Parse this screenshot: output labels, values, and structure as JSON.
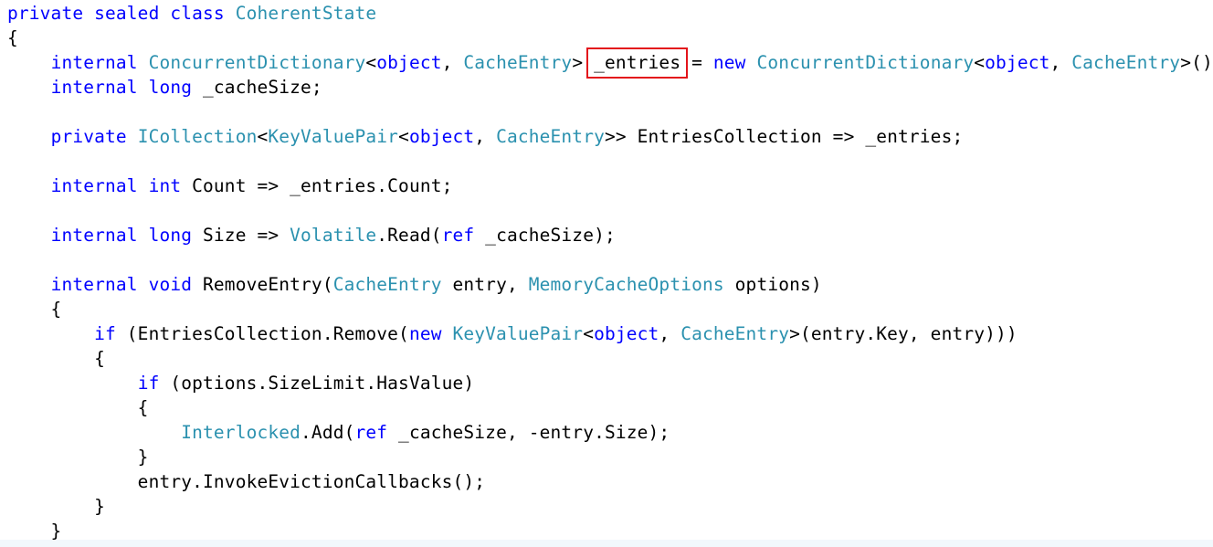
{
  "colors": {
    "keyword": "#0000ff",
    "type": "#2b91af",
    "text": "#000000",
    "highlight_box": "#e3141b",
    "background": "#ffffff"
  },
  "code_lines": [
    [
      {
        "t": "private",
        "k": "kw"
      },
      {
        "t": " ",
        "k": "pl"
      },
      {
        "t": "sealed",
        "k": "kw"
      },
      {
        "t": " ",
        "k": "pl"
      },
      {
        "t": "class",
        "k": "kw"
      },
      {
        "t": " ",
        "k": "pl"
      },
      {
        "t": "CoherentState",
        "k": "ty"
      }
    ],
    [
      {
        "t": "{",
        "k": "pl"
      }
    ],
    [
      {
        "t": "    ",
        "k": "pl"
      },
      {
        "t": "internal",
        "k": "kw"
      },
      {
        "t": " ",
        "k": "pl"
      },
      {
        "t": "ConcurrentDictionary",
        "k": "ty"
      },
      {
        "t": "<",
        "k": "pl"
      },
      {
        "t": "object",
        "k": "kw"
      },
      {
        "t": ", ",
        "k": "pl"
      },
      {
        "t": "CacheEntry",
        "k": "ty"
      },
      {
        "t": "> ",
        "k": "pl"
      },
      {
        "t": "_entries",
        "k": "hl"
      },
      {
        "t": " = ",
        "k": "pl"
      },
      {
        "t": "new",
        "k": "kw"
      },
      {
        "t": " ",
        "k": "pl"
      },
      {
        "t": "ConcurrentDictionary",
        "k": "ty"
      },
      {
        "t": "<",
        "k": "pl"
      },
      {
        "t": "object",
        "k": "kw"
      },
      {
        "t": ", ",
        "k": "pl"
      },
      {
        "t": "CacheEntry",
        "k": "ty"
      },
      {
        "t": ">()",
        "k": "pl"
      }
    ],
    [
      {
        "t": "    ",
        "k": "pl"
      },
      {
        "t": "internal",
        "k": "kw"
      },
      {
        "t": " ",
        "k": "pl"
      },
      {
        "t": "long",
        "k": "kw"
      },
      {
        "t": " _cacheSize;",
        "k": "pl"
      }
    ],
    [],
    [
      {
        "t": "    ",
        "k": "pl"
      },
      {
        "t": "private",
        "k": "kw"
      },
      {
        "t": " ",
        "k": "pl"
      },
      {
        "t": "ICollection",
        "k": "ty"
      },
      {
        "t": "<",
        "k": "pl"
      },
      {
        "t": "KeyValuePair",
        "k": "ty"
      },
      {
        "t": "<",
        "k": "pl"
      },
      {
        "t": "object",
        "k": "kw"
      },
      {
        "t": ", ",
        "k": "pl"
      },
      {
        "t": "CacheEntry",
        "k": "ty"
      },
      {
        "t": ">> EntriesCollection => _entries;",
        "k": "pl"
      }
    ],
    [],
    [
      {
        "t": "    ",
        "k": "pl"
      },
      {
        "t": "internal",
        "k": "kw"
      },
      {
        "t": " ",
        "k": "pl"
      },
      {
        "t": "int",
        "k": "kw"
      },
      {
        "t": " Count => _entries.Count;",
        "k": "pl"
      }
    ],
    [],
    [
      {
        "t": "    ",
        "k": "pl"
      },
      {
        "t": "internal",
        "k": "kw"
      },
      {
        "t": " ",
        "k": "pl"
      },
      {
        "t": "long",
        "k": "kw"
      },
      {
        "t": " Size => ",
        "k": "pl"
      },
      {
        "t": "Volatile",
        "k": "ty"
      },
      {
        "t": ".Read(",
        "k": "pl"
      },
      {
        "t": "ref",
        "k": "kw"
      },
      {
        "t": " _cacheSize);",
        "k": "pl"
      }
    ],
    [],
    [
      {
        "t": "    ",
        "k": "pl"
      },
      {
        "t": "internal",
        "k": "kw"
      },
      {
        "t": " ",
        "k": "pl"
      },
      {
        "t": "void",
        "k": "kw"
      },
      {
        "t": " RemoveEntry(",
        "k": "pl"
      },
      {
        "t": "CacheEntry",
        "k": "ty"
      },
      {
        "t": " entry, ",
        "k": "pl"
      },
      {
        "t": "MemoryCacheOptions",
        "k": "ty"
      },
      {
        "t": " options)",
        "k": "pl"
      }
    ],
    [
      {
        "t": "    {",
        "k": "pl"
      }
    ],
    [
      {
        "t": "        ",
        "k": "pl"
      },
      {
        "t": "if",
        "k": "kw"
      },
      {
        "t": " (EntriesCollection.Remove(",
        "k": "pl"
      },
      {
        "t": "new",
        "k": "kw"
      },
      {
        "t": " ",
        "k": "pl"
      },
      {
        "t": "KeyValuePair",
        "k": "ty"
      },
      {
        "t": "<",
        "k": "pl"
      },
      {
        "t": "object",
        "k": "kw"
      },
      {
        "t": ", ",
        "k": "pl"
      },
      {
        "t": "CacheEntry",
        "k": "ty"
      },
      {
        "t": ">(entry.Key, entry)))",
        "k": "pl"
      }
    ],
    [
      {
        "t": "        {",
        "k": "pl"
      }
    ],
    [
      {
        "t": "            ",
        "k": "pl"
      },
      {
        "t": "if",
        "k": "kw"
      },
      {
        "t": " (options.SizeLimit.HasValue)",
        "k": "pl"
      }
    ],
    [
      {
        "t": "            {",
        "k": "pl"
      }
    ],
    [
      {
        "t": "                ",
        "k": "pl"
      },
      {
        "t": "Interlocked",
        "k": "ty"
      },
      {
        "t": ".Add(",
        "k": "pl"
      },
      {
        "t": "ref",
        "k": "kw"
      },
      {
        "t": " _cacheSize, -entry.Size);",
        "k": "pl"
      }
    ],
    [
      {
        "t": "            }",
        "k": "pl"
      }
    ],
    [
      {
        "t": "            entry.InvokeEvictionCallbacks();",
        "k": "pl"
      }
    ],
    [
      {
        "t": "        }",
        "k": "pl"
      }
    ],
    [
      {
        "t": "    }",
        "k": "pl"
      }
    ]
  ]
}
